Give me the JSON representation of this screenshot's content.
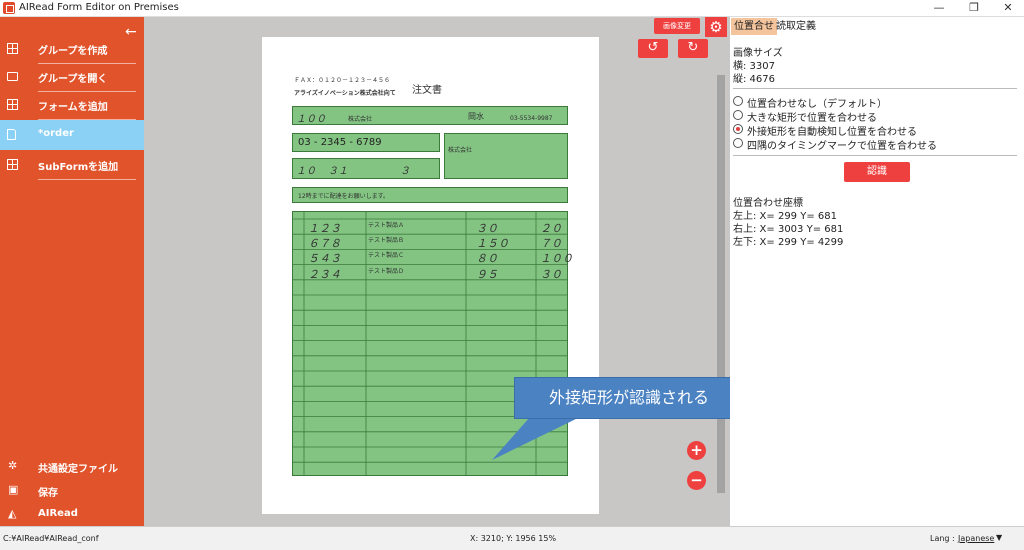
{
  "window": {
    "title": "AIRead Form Editor on Premises",
    "min": "—",
    "max": "❐",
    "close": "✕"
  },
  "sidebar": {
    "back": "←",
    "items": [
      {
        "label": "グループを作成",
        "icon": "plus-box-icon"
      },
      {
        "label": "グループを開く",
        "icon": "folder-open-icon"
      },
      {
        "label": "フォームを追加",
        "icon": "plus-box-icon"
      },
      {
        "label": "*order",
        "icon": "document-icon"
      },
      {
        "label": "SubFormを追加",
        "icon": "plus-box-icon"
      }
    ],
    "bottom": [
      {
        "label": "共通設定ファイル",
        "icon_char": "✲"
      },
      {
        "label": "保存",
        "icon_char": "▣"
      },
      {
        "label": "AIRead",
        "icon_char": "◭"
      }
    ]
  },
  "canvas": {
    "image_change": "画像変更",
    "rotate_left": "↺",
    "rotate_right": "↻",
    "zoom_in": "+",
    "zoom_out": "−",
    "callout": "外接矩形が認識される"
  },
  "form": {
    "fax": "ＦＡＸ：０１２０－１２３－４５６",
    "title": "注文書",
    "company": "アライズイノベーション株式会社向て",
    "code": "１００",
    "customer": "株式会社",
    "person": "岡水",
    "phone_small": "03-5534-9987",
    "tel": "03 - 2345 - 6789",
    "ship": "株式会社",
    "date1": "１０",
    "date2": "３１",
    "date3": "３",
    "memo": "12時までに配達をお願いします。",
    "rows": [
      {
        "code": "１２３",
        "name": "テスト製品Ａ",
        "qty": "３０",
        "amt": "２０"
      },
      {
        "code": "６７８",
        "name": "テスト製品Ｂ",
        "qty": "１５０",
        "amt": "７０"
      },
      {
        "code": "５４３",
        "name": "テスト製品Ｃ",
        "qty": "８０",
        "amt": "１００"
      },
      {
        "code": "２３４",
        "name": "テスト製品Ｄ",
        "qty": "９５",
        "amt": "３０"
      }
    ]
  },
  "panel": {
    "tab_align": "位置合せ",
    "tab_read": "読取定義",
    "img_size_label": "画像サイズ",
    "width": "横: 3307",
    "height": "縦: 4676",
    "options": [
      "位置合わせなし（デフォルト）",
      "大きな矩形で位置を合わせる",
      "外接矩形を自動検知し位置を合わせる",
      "四隅のタイミングマークで位置を合わせる"
    ],
    "selected": 2,
    "recognize": "認識",
    "coords_title": "位置合わせ座標",
    "coord1": "左上: X= 299   Y= 681",
    "coord2": "右上: X= 3003   Y= 681",
    "coord3": "左下: X= 299   Y= 4299"
  },
  "status": {
    "path": "C:¥AIRead¥AIRead_conf",
    "cursor": "X: 3210; Y: 1956   15%",
    "lang_label": "Lang :",
    "lang_value": "Japanese"
  }
}
